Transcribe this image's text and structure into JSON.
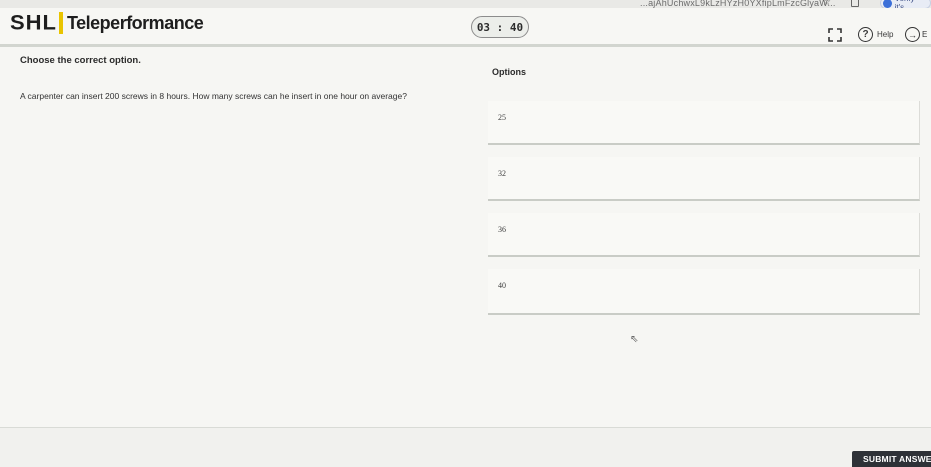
{
  "browser": {
    "url_fragment": "...ajAhUchwxL9kLzHYzH0YXfipLmFzcGlyaW...",
    "verify_label": "Verify it's"
  },
  "header": {
    "brand": "SHL",
    "product": "Teleperformance",
    "timer": "03 : 40",
    "help_label": "Help",
    "exit_label": "E"
  },
  "main": {
    "instruction": "Choose the correct option.",
    "question": "A carpenter can insert 200 screws in 8 hours. How many screws can he insert in one hour on average?",
    "options_label": "Options",
    "options": [
      "25",
      "32",
      "36",
      "40"
    ]
  },
  "footer": {
    "submit_label": "SUBMIT ANSWE"
  },
  "colors": {
    "background": "#f4f4f1",
    "brand_accent": "#e9c400",
    "submit_bg": "#2e3137"
  },
  "icons": [
    "star-icon",
    "extension-icon",
    "verify-icon",
    "fullscreen-icon",
    "help-icon",
    "exit-icon",
    "cursor-icon"
  ]
}
